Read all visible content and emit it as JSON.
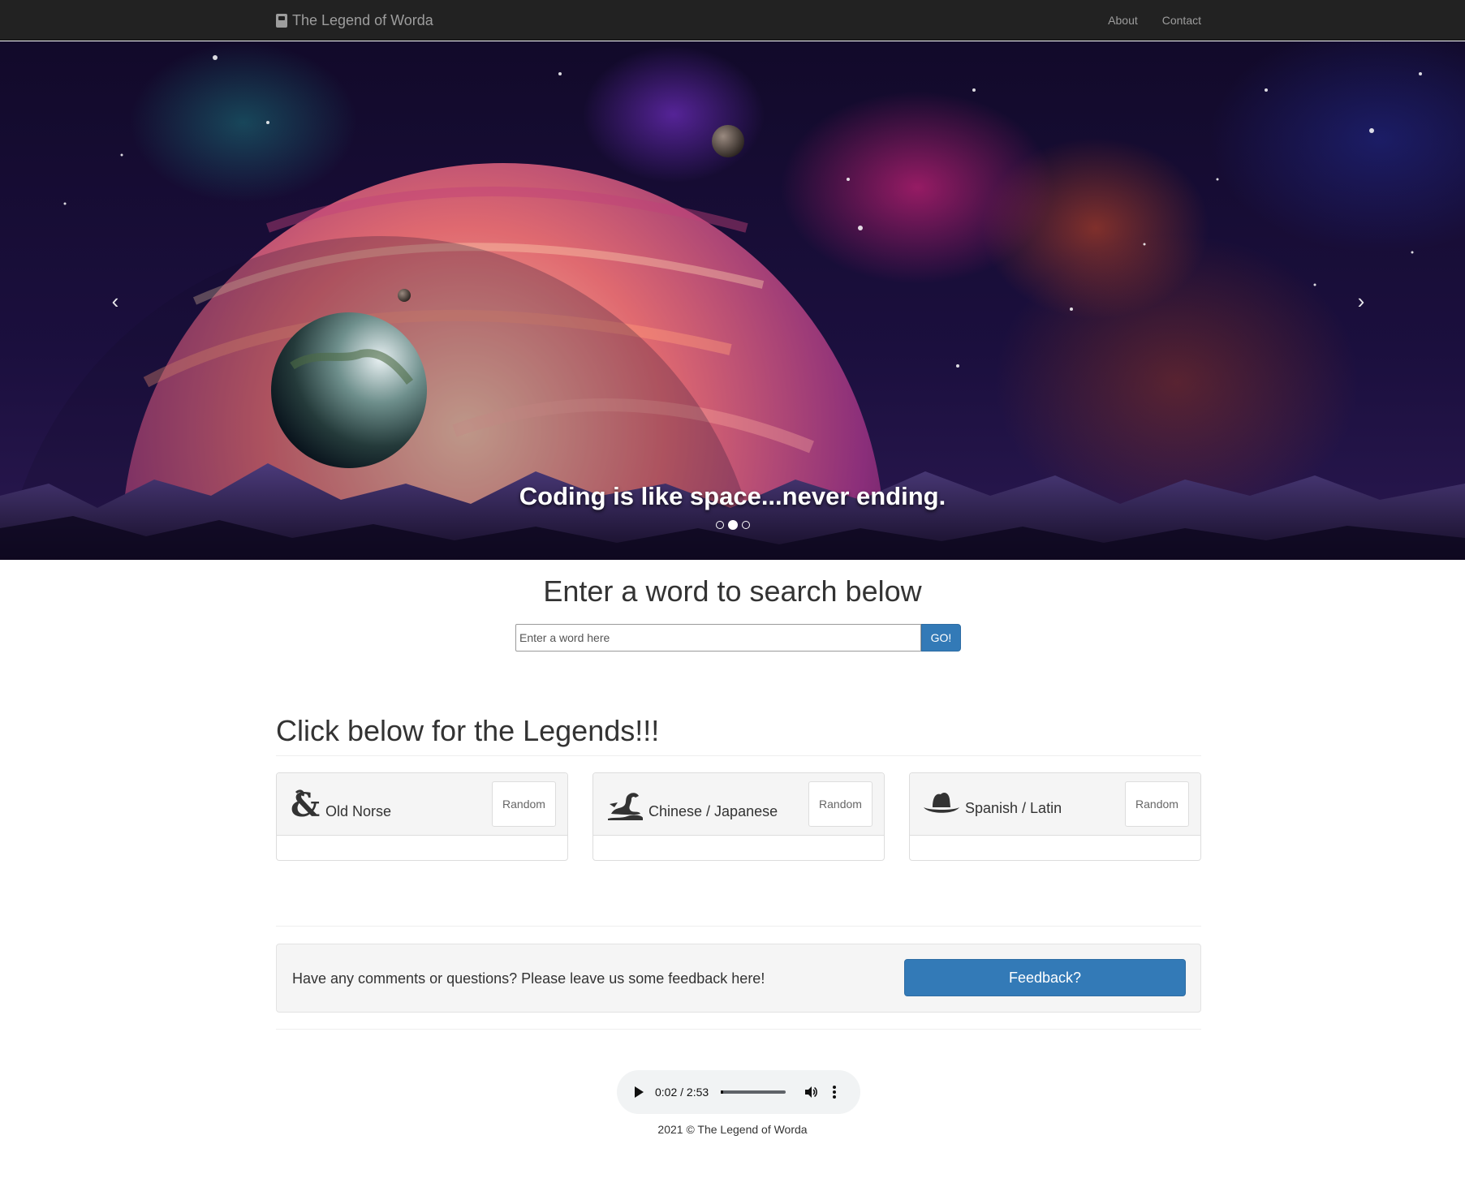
{
  "navbar": {
    "brand": "The Legend of Worda",
    "links": [
      "About",
      "Contact"
    ]
  },
  "carousel": {
    "caption": "Coding is like space...never ending.",
    "slide_count": 3,
    "active_slide": 2,
    "prev_icon": "chevron-left-icon",
    "next_icon": "chevron-right-icon"
  },
  "search": {
    "heading": "Enter a word to search below",
    "placeholder": "Enter a word here",
    "value": "",
    "button": "GO!"
  },
  "legends": {
    "heading": "Click below for the Legends!!!",
    "panels": [
      {
        "title": "Old Norse",
        "icon": "dragon-ampersand-icon",
        "button": "Random"
      },
      {
        "title": "Chinese / Japanese",
        "icon": "dragon-icon",
        "button": "Random"
      },
      {
        "title": "Spanish / Latin",
        "icon": "hat-cowboy-icon",
        "button": "Random"
      }
    ]
  },
  "feedback": {
    "text": "Have any comments or questions? Please leave us some feedback here!",
    "button": "Feedback?"
  },
  "audio": {
    "time": "0:02 / 2:53",
    "progress": 0.012
  },
  "footer": {
    "text": "2021 © The Legend of Worda"
  },
  "colors": {
    "navbar_bg": "#222222",
    "primary": "#337ab7",
    "panel_head_bg": "#f5f5f5"
  }
}
